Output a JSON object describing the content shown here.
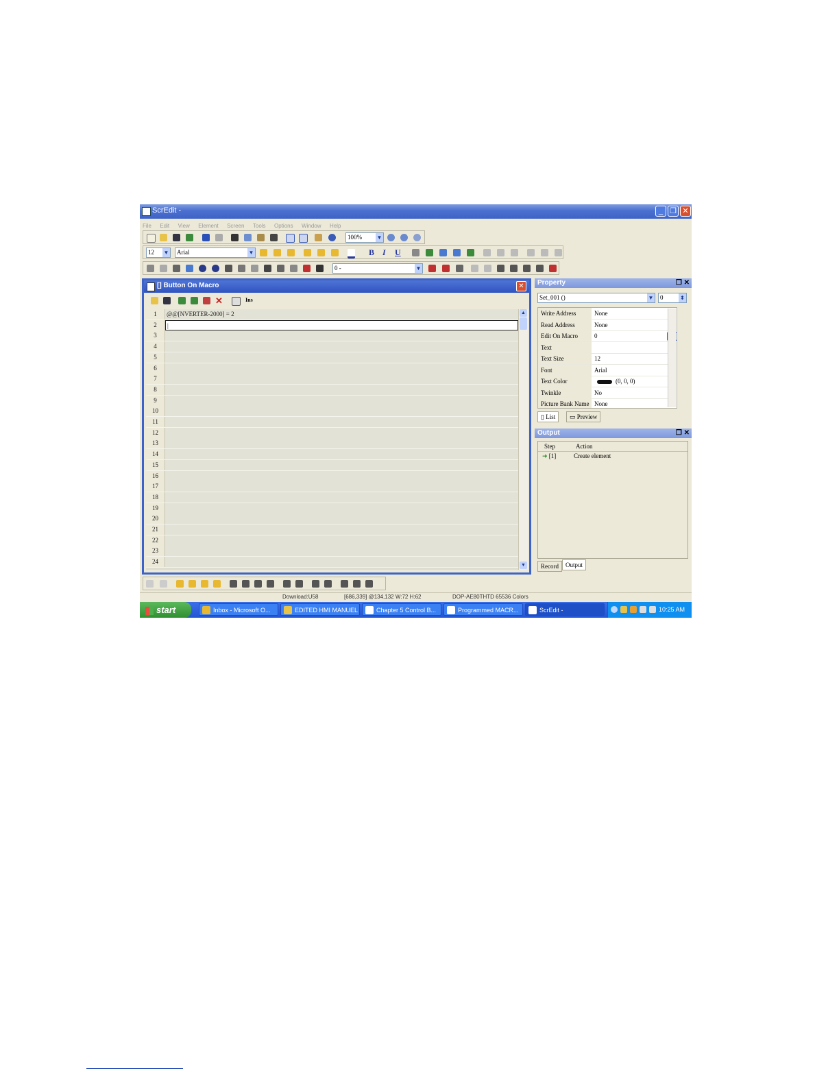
{
  "window": {
    "title": "ScrEdit -"
  },
  "menu": [
    "File",
    "Edit",
    "View",
    "Element",
    "Screen",
    "Tools",
    "Options",
    "Window",
    "Help"
  ],
  "toolbar": {
    "zoom": "100%",
    "font_size": "12",
    "font_name": "Arial",
    "bold": "B",
    "italic": "I",
    "underline": "U",
    "layer_combo": "0 -"
  },
  "macro": {
    "title": "[] Button On Macro",
    "ins_label": "Ins",
    "lines": [
      {
        "n": "1",
        "text": "@@[NVERTER-2000] = 2"
      },
      {
        "n": "2",
        "text": "|"
      },
      {
        "n": "3",
        "text": ""
      },
      {
        "n": "4",
        "text": ""
      },
      {
        "n": "5",
        "text": ""
      },
      {
        "n": "6",
        "text": ""
      },
      {
        "n": "7",
        "text": ""
      },
      {
        "n": "8",
        "text": ""
      },
      {
        "n": "9",
        "text": ""
      },
      {
        "n": "10",
        "text": ""
      },
      {
        "n": "11",
        "text": ""
      },
      {
        "n": "12",
        "text": ""
      },
      {
        "n": "13",
        "text": ""
      },
      {
        "n": "14",
        "text": ""
      },
      {
        "n": "15",
        "text": ""
      },
      {
        "n": "16",
        "text": ""
      },
      {
        "n": "17",
        "text": ""
      },
      {
        "n": "18",
        "text": ""
      },
      {
        "n": "19",
        "text": ""
      },
      {
        "n": "20",
        "text": ""
      },
      {
        "n": "21",
        "text": ""
      },
      {
        "n": "22",
        "text": ""
      },
      {
        "n": "23",
        "text": ""
      },
      {
        "n": "24",
        "text": ""
      }
    ]
  },
  "property": {
    "title": "Property",
    "element_combo": "Set_001 ()",
    "index_combo": "0",
    "rows": [
      {
        "k": "Write Address",
        "v": "None"
      },
      {
        "k": "Read Address",
        "v": "None"
      },
      {
        "k": "Edit On Macro",
        "v": "0"
      },
      {
        "k": "Text",
        "v": ""
      },
      {
        "k": "Text Size",
        "v": "12"
      },
      {
        "k": "Font",
        "v": "Arial"
      },
      {
        "k": "Text Color",
        "v": "(0, 0, 0)"
      },
      {
        "k": "Twinkle",
        "v": "No"
      },
      {
        "k": "Picture Bank Name",
        "v": "None"
      }
    ],
    "tabs": [
      "List",
      "Preview"
    ]
  },
  "output": {
    "title": "Output",
    "headers": [
      "Step",
      "Action"
    ],
    "rows": [
      {
        "step": "[1]",
        "action": "Create element"
      }
    ],
    "tabs": [
      "Record",
      "Output"
    ]
  },
  "status": {
    "download": "Download:U58",
    "coords": "[686,339] @134,132 W:72 H:62",
    "device": "DOP-AE80THTD 65536 Colors"
  },
  "taskbar": {
    "start": "start",
    "tasks": [
      "Inbox - Microsoft O...",
      "EDITED HMI MANUEL",
      "Chapter 5 Control B...",
      "Programmed MACR...",
      "ScrEdit -"
    ],
    "clock": "10:25 AM"
  },
  "colors": {
    "title_blue": "#3e63c8",
    "taskbar_blue": "#2455d4",
    "close_red": "#d8502e",
    "start_green": "#3a9a3a"
  }
}
